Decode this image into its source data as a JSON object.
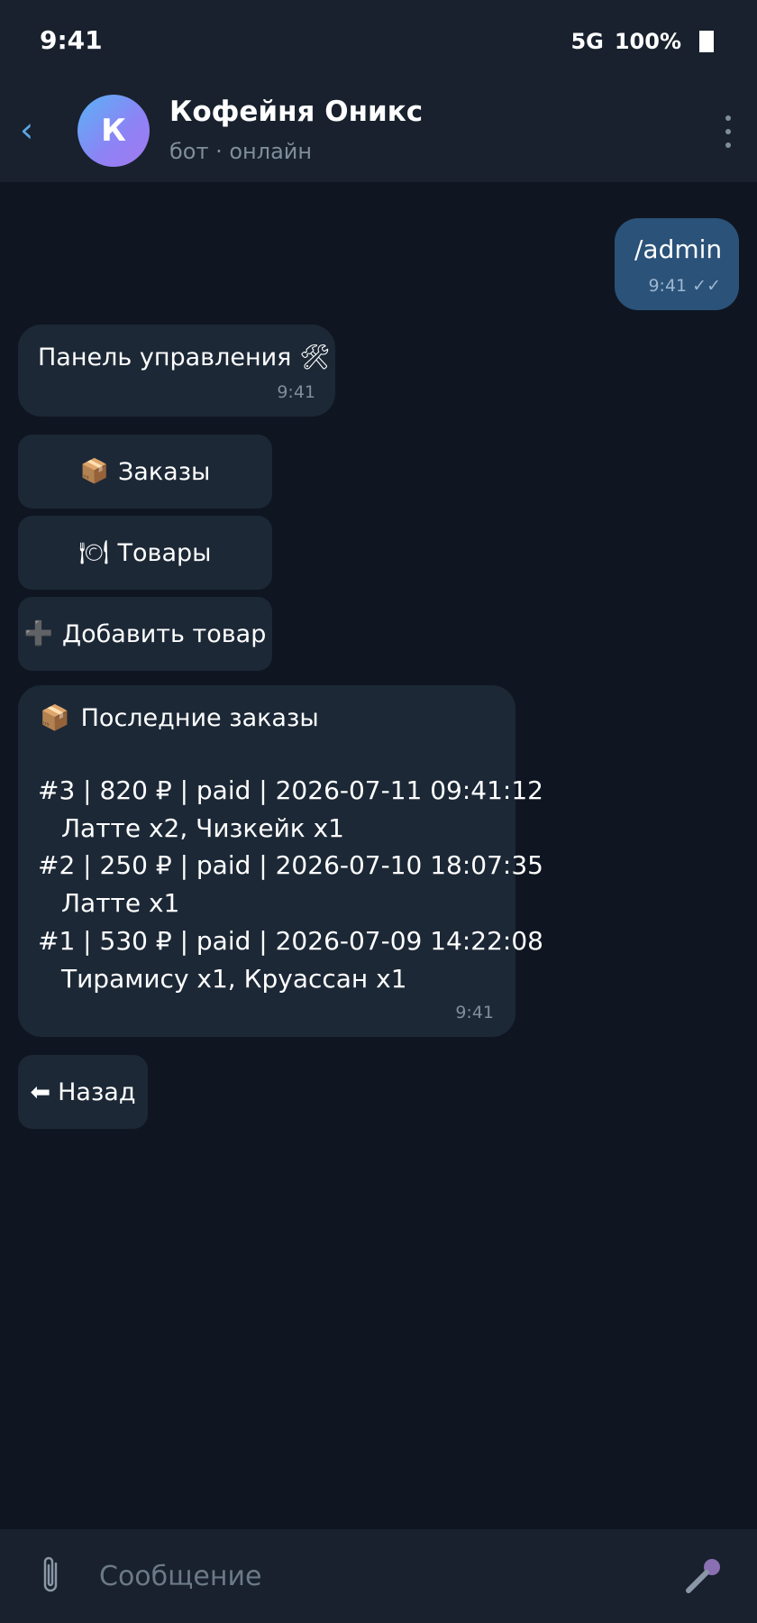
{
  "status_bar": {
    "time": "9:41",
    "network": "5G",
    "battery": "100%"
  },
  "header": {
    "avatar_letter": "К",
    "title": "Кофейня Оникс",
    "subtitle": "бот · онлайн"
  },
  "messages": {
    "outgoing": {
      "text": "/admin",
      "time": "9:41 ✓✓"
    },
    "panel": {
      "text": "Панель управления 🛠",
      "time": "9:41"
    }
  },
  "keyboard": {
    "orders": {
      "icon": "📦",
      "label": "Заказы"
    },
    "products": {
      "icon": "🍽",
      "label": "Товары"
    },
    "add_product": {
      "icon": "➕",
      "label": "Добавить товар"
    }
  },
  "orders_card": {
    "icon": "📦",
    "heading": "Последние заказы",
    "orders": [
      {
        "line": "#3 | 820 ₽ | paid | 2026-07-11 09:41:12",
        "items": "Латте x2, Чизкейк x1"
      },
      {
        "line": "#2 | 250 ₽ | paid | 2026-07-10 18:07:35",
        "items": "Латте x1"
      },
      {
        "line": "#1 | 530 ₽ | paid | 2026-07-09 14:22:08",
        "items": "Тирамису x1, Круассан x1"
      }
    ],
    "time": "9:41"
  },
  "back_button": {
    "icon": "⬅",
    "label": "Назад"
  },
  "input": {
    "placeholder": "Сообщение"
  },
  "colors": {
    "background": "#0f1621",
    "bar": "#18212d",
    "bubble_in": "#1c2836",
    "bubble_out": "#2b5279",
    "accent": "#5ba7e6"
  }
}
